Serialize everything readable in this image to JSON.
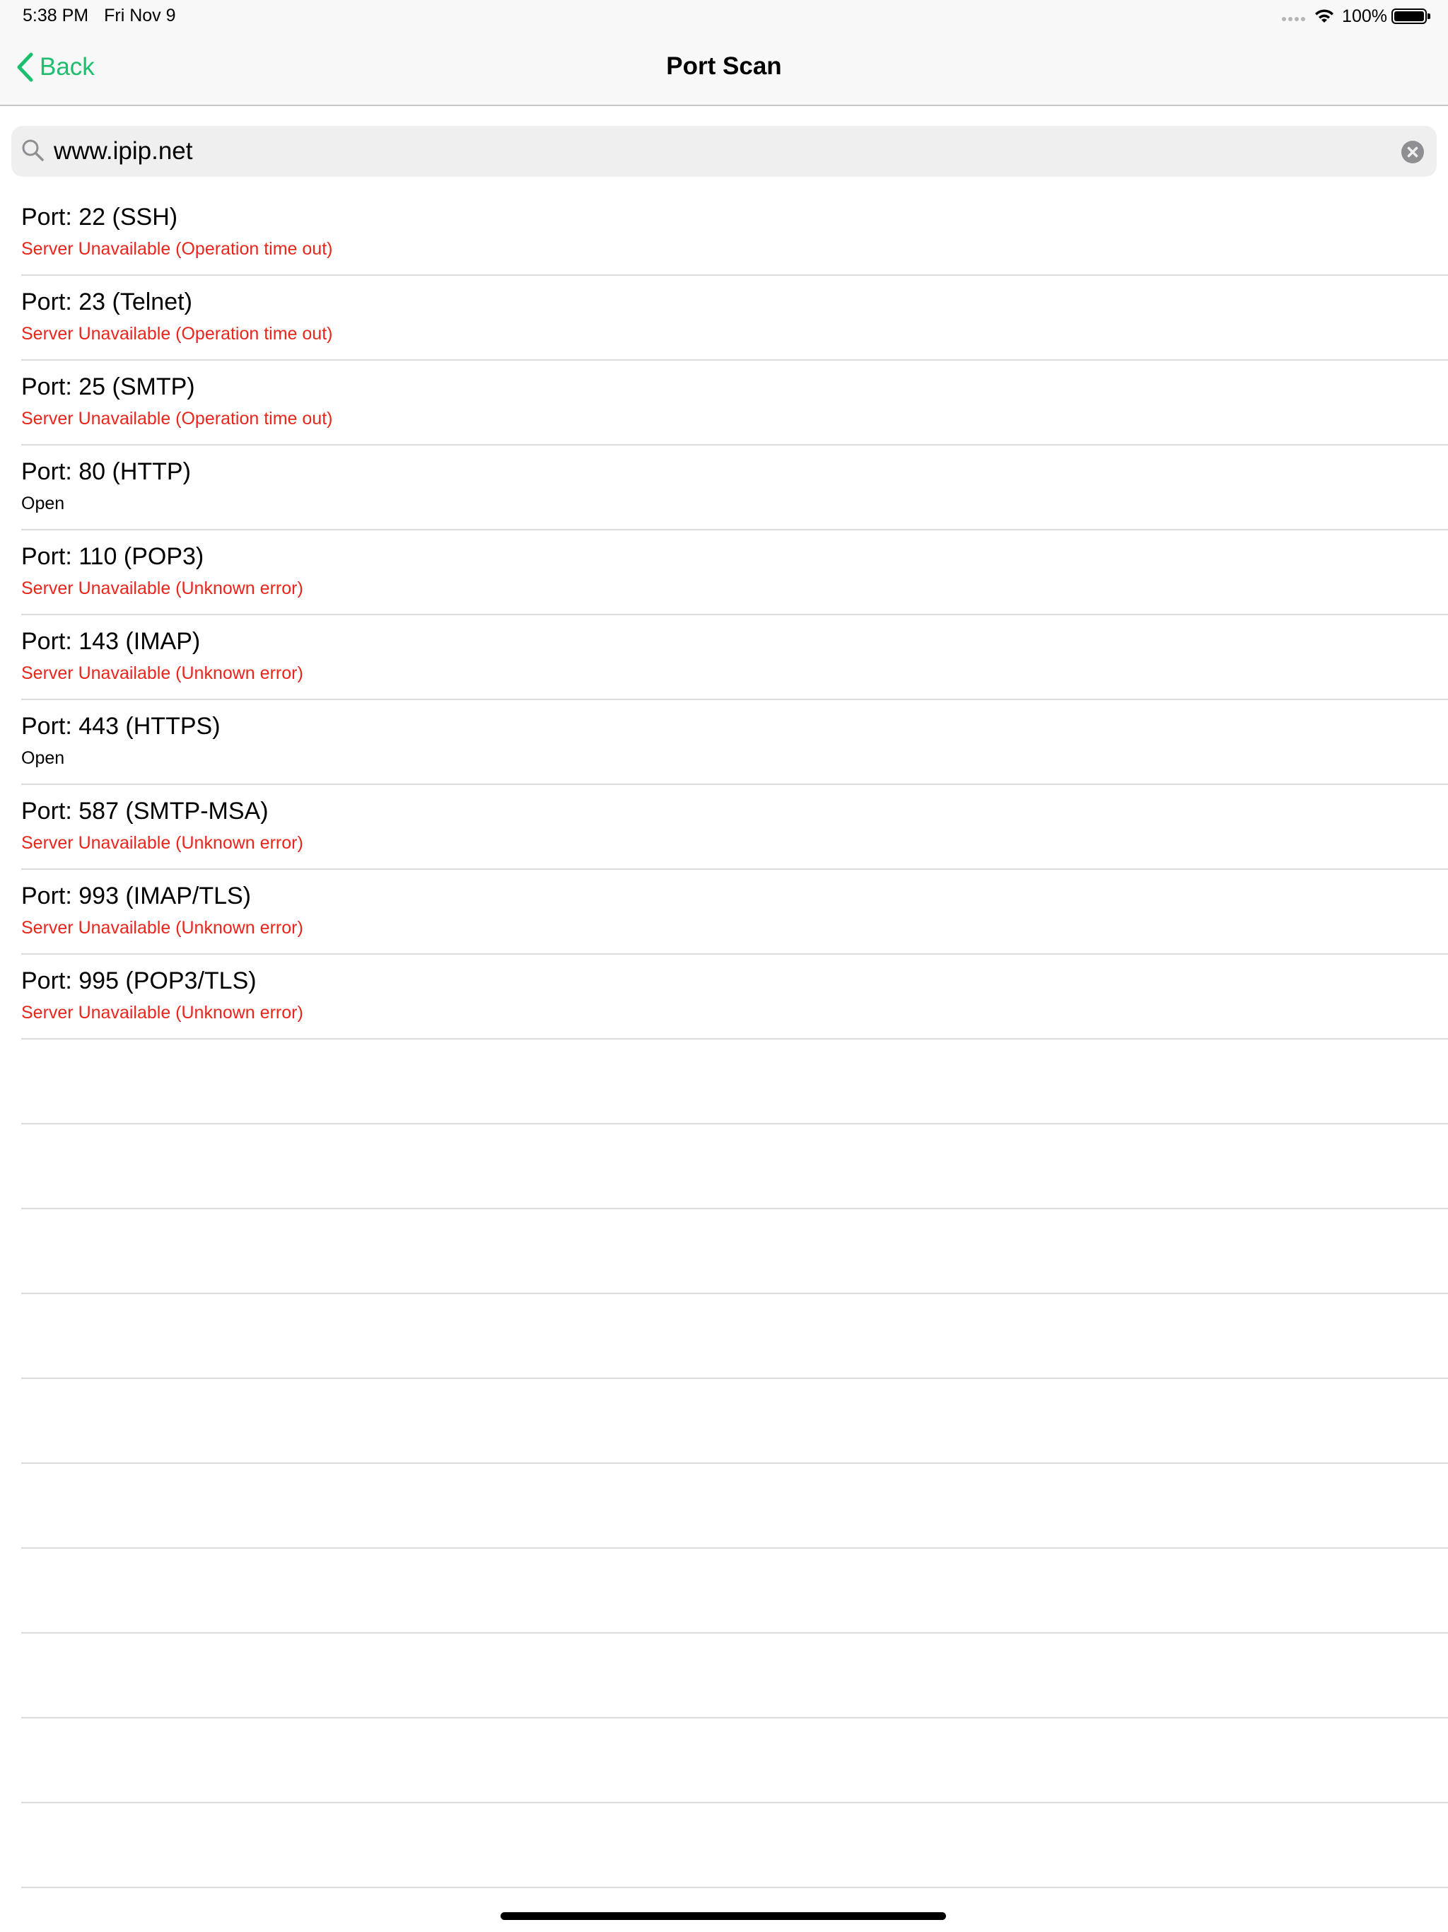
{
  "status_bar": {
    "time": "5:38 PM",
    "date": "Fri Nov 9",
    "battery_percent": "100%",
    "battery_level": 1.0
  },
  "nav": {
    "back_label": "Back",
    "title": "Port Scan",
    "accent_color": "#1dbf6e"
  },
  "search": {
    "value": "www.ipip.net",
    "icon": "search-icon",
    "clear_icon": "clear-icon"
  },
  "ports": [
    {
      "title": "Port: 22 (SSH)",
      "status": "Server Unavailable (Operation time out)",
      "state": "error"
    },
    {
      "title": "Port: 23 (Telnet)",
      "status": "Server Unavailable (Operation time out)",
      "state": "error"
    },
    {
      "title": "Port: 25 (SMTP)",
      "status": "Server Unavailable (Operation time out)",
      "state": "error"
    },
    {
      "title": "Port: 80 (HTTP)",
      "status": "Open",
      "state": "open"
    },
    {
      "title": "Port: 110 (POP3)",
      "status": "Server Unavailable (Unknown error)",
      "state": "error"
    },
    {
      "title": "Port: 143 (IMAP)",
      "status": "Server Unavailable (Unknown error)",
      "state": "error"
    },
    {
      "title": "Port: 443 (HTTPS)",
      "status": "Open",
      "state": "open"
    },
    {
      "title": "Port: 587 (SMTP-MSA)",
      "status": "Server Unavailable (Unknown error)",
      "state": "error"
    },
    {
      "title": "Port: 993 (IMAP/TLS)",
      "status": "Server Unavailable (Unknown error)",
      "state": "error"
    },
    {
      "title": "Port: 995 (POP3/TLS)",
      "status": "Server Unavailable (Unknown error)",
      "state": "error"
    }
  ],
  "colors": {
    "error": "#e8261c",
    "open": "#000000"
  }
}
